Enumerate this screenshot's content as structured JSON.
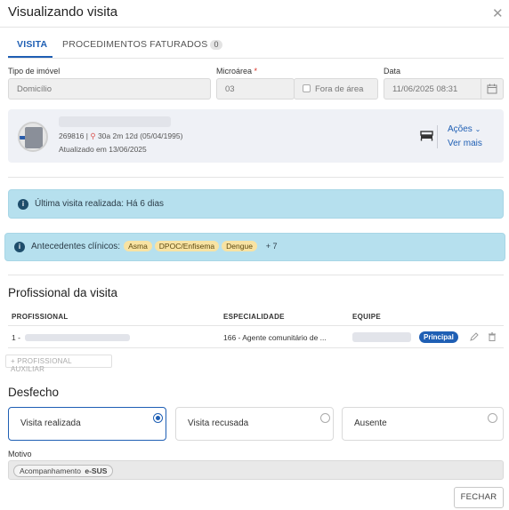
{
  "modal": {
    "title": "Visualizando visita",
    "close_icon": "close-icon"
  },
  "tabs": [
    {
      "label": "VISITA",
      "active": true
    },
    {
      "label": "PROCEDIMENTOS FATURADOS",
      "count": "0",
      "active": false
    }
  ],
  "form": {
    "tipo_imovel": {
      "label": "Tipo de imóvel",
      "value": "Domicílio"
    },
    "microarea": {
      "label": "Microárea",
      "required_mark": "*",
      "value": "03",
      "fora_label": "Fora de área",
      "fora_checked": false
    },
    "data": {
      "label": "Data",
      "value": "11/06/2025 08:31",
      "icon": "calendar-icon"
    }
  },
  "patient_card": {
    "id": "269816",
    "separator": "|",
    "age": "30a 2m 12d (05/04/1995)",
    "updated": "Atualizado em 13/06/2025",
    "acoes_label": "Ações",
    "ver_mais_label": "Ver mais",
    "icons": [
      "bed-icon",
      "location-pin-icon",
      "chevron-down-icon"
    ]
  },
  "alerts": {
    "ultima_visita": "Última visita realizada: Há 6 dias",
    "antecedentes_label": "Antecedentes clínicos:",
    "antecedentes_tags": [
      "Asma",
      "DPOC/Enfisema",
      "Dengue"
    ],
    "antecedentes_more": "+ 7"
  },
  "profissional": {
    "title": "Profissional da visita",
    "headers": {
      "profissional": "PROFISSIONAL",
      "especialidade": "ESPECIALIDADE",
      "equipe": "EQUIPE"
    },
    "rows": [
      {
        "profissional": "1 -",
        "especialidade": "166 - Agente comunitário de ...",
        "badge": "Principal"
      }
    ],
    "add_aux_label": "+ PROFISSIONAL AUXILIAR"
  },
  "desfecho": {
    "title": "Desfecho",
    "options": [
      {
        "label": "Visita realizada",
        "selected": true
      },
      {
        "label": "Visita recusada",
        "selected": false
      },
      {
        "label": "Ausente",
        "selected": false
      }
    ]
  },
  "motivo": {
    "label": "Motivo",
    "chip_text": "Acompanhamento",
    "chip_tag": "e-SUS"
  },
  "footer": {
    "fechar_label": "FECHAR"
  },
  "colors": {
    "accent": "#1f5fb4",
    "alert_bg": "#b6e0ee",
    "tag_bg": "#f8e3a3",
    "card_bg": "#eff1f6"
  }
}
